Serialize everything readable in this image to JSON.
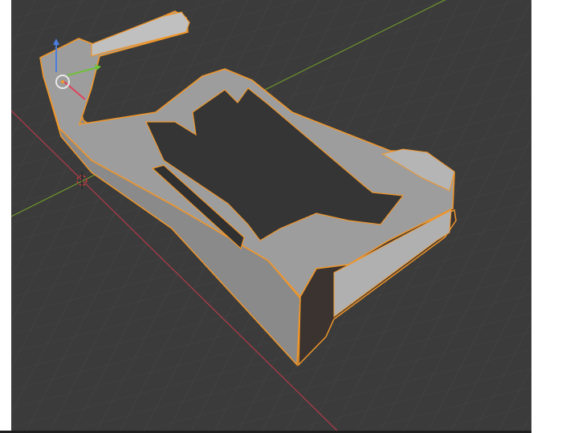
{
  "viewport": {
    "background": "#3b3b3b",
    "grid_color": "#4a4a4a",
    "x_axis_color": "#b43a4a",
    "y_axis_color": "#6f9a2a",
    "selection_outline_color": "#f0962a",
    "object_color": "#9a9a9a"
  },
  "gizmo": {
    "icons": [
      "move-x-arrow-icon",
      "move-y-arrow-icon",
      "move-z-arrow-icon",
      "origin-circle-icon"
    ]
  },
  "cursor_3d": {
    "icon": "3d-cursor-icon"
  }
}
